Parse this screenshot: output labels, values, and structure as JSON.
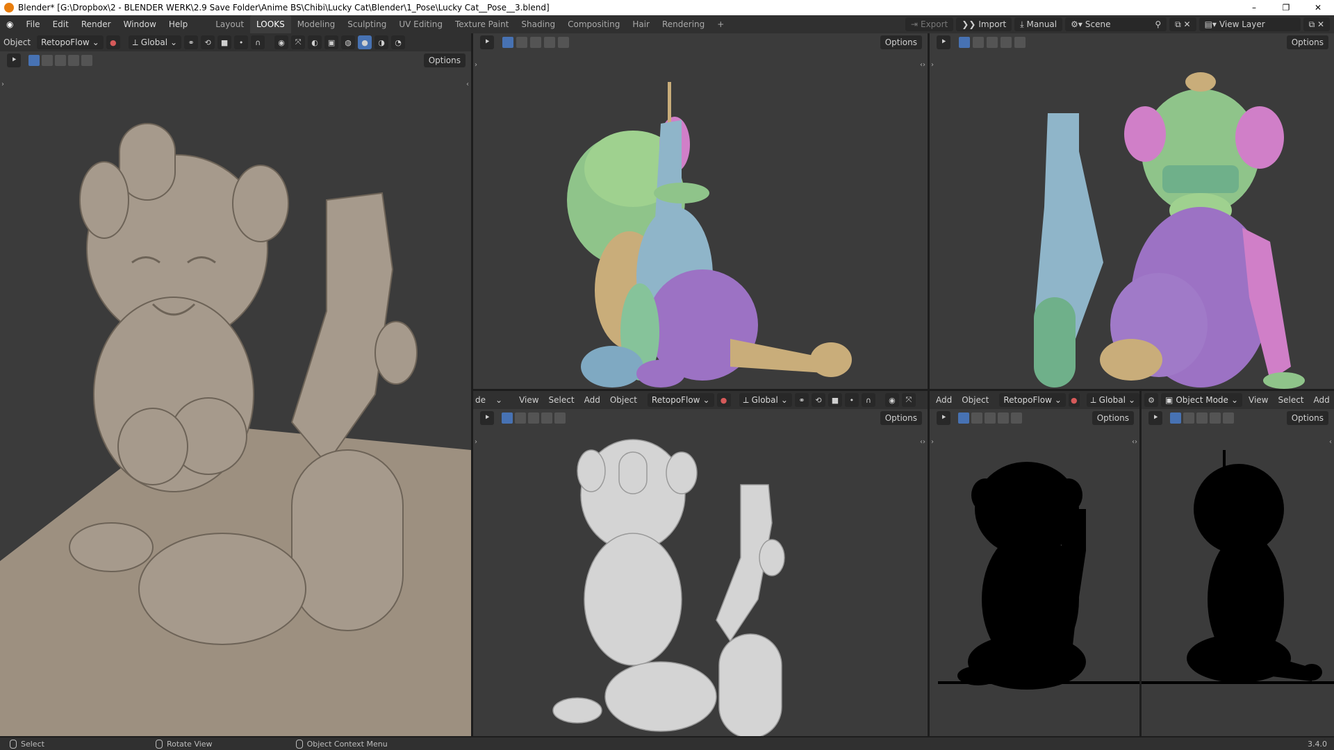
{
  "window": {
    "title": "Blender* [G:\\Dropbox\\2 - BLENDER WERK\\2.9 Save Folder\\Anime BS\\Chibi\\Lucky Cat\\Blender\\1_Pose\\Lucky Cat__Pose__3.blend]",
    "controls": [
      "–",
      "❐",
      "✕"
    ]
  },
  "menu": {
    "items": [
      "File",
      "Edit",
      "Render",
      "Window",
      "Help"
    ],
    "workspaces": [
      "Layout",
      "LOOKS",
      "Modeling",
      "Sculpting",
      "UV Editing",
      "Texture Paint",
      "Shading",
      "Compositing",
      "Hair",
      "Rendering",
      "+"
    ],
    "active_workspace": "LOOKS",
    "export_label": "Export",
    "import_label": "Import",
    "manual_label": "Manual",
    "scene_label": "Scene",
    "view_layer_label": "View Layer"
  },
  "viewport_left": {
    "mode_label": "Object",
    "addon_label": "RetopoFlow",
    "orientation_label": "Global",
    "options_label": "Options",
    "model_color": "#9d9080"
  },
  "viewport_top_mid": {
    "options_label": "Options"
  },
  "viewport_top_right": {
    "options_label": "Options"
  },
  "viewport_bottom_mid": {
    "mode_label": "de",
    "menus": [
      "View",
      "Select",
      "Add",
      "Object"
    ],
    "addon_label": "RetopoFlow",
    "orientation_label": "Global",
    "options_label": "Options"
  },
  "viewport_bottom_right_a": {
    "menus": [
      "Add",
      "Object"
    ],
    "addon_label": "RetopoFlow",
    "orientation_label": "Global",
    "options_label": "Options"
  },
  "viewport_bottom_right_b": {
    "mode_label": "Object Mode",
    "menus": [
      "View",
      "Select",
      "Add"
    ],
    "options_label": "Options"
  },
  "status": {
    "select_label": "Select",
    "rotate_label": "Rotate View",
    "context_label": "Object Context Menu",
    "version": "3.4.0"
  },
  "colors": {
    "accent": "#4772b3",
    "skin_green": "#8fc48a",
    "skin_blue": "#8fb5c9",
    "skin_purple": "#9c72c4",
    "skin_pink": "#d07fc8",
    "skin_tan": "#c9ad7a"
  }
}
